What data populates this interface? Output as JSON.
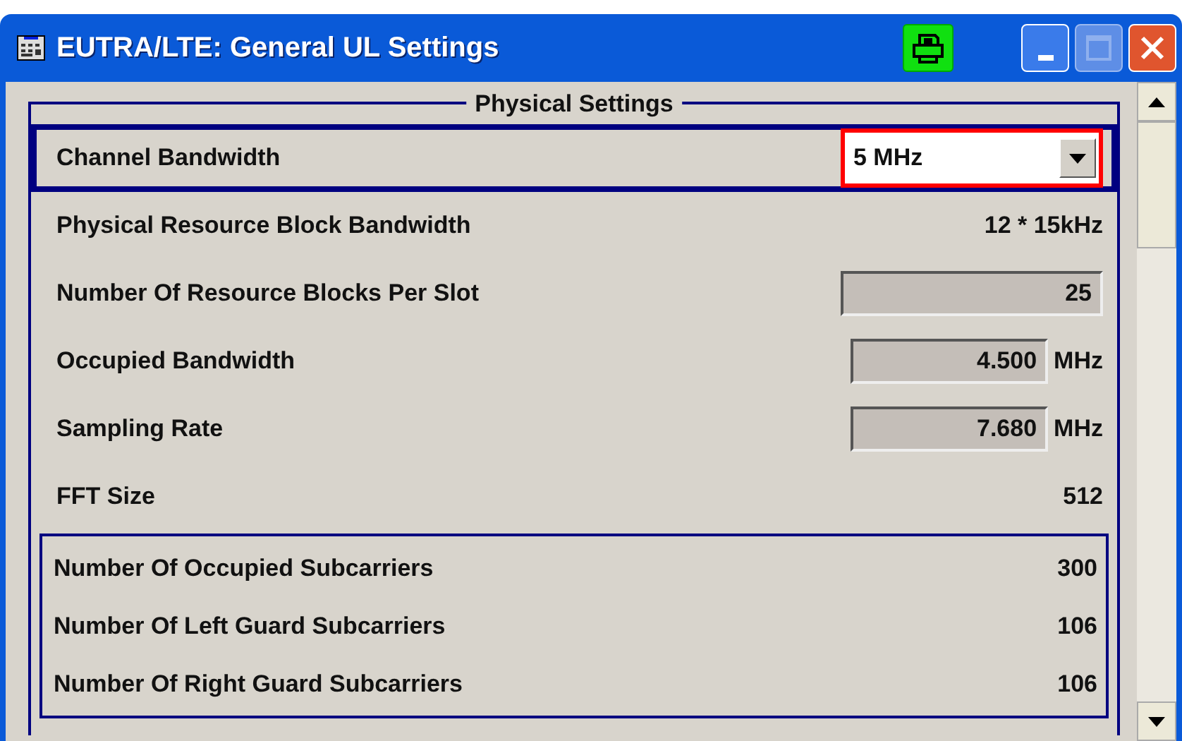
{
  "window": {
    "title": "EUTRA/LTE: General UL Settings"
  },
  "group": {
    "title": "Physical Settings",
    "rows": [
      {
        "kind": "dropdown",
        "label": "Channel Bandwidth",
        "value": "5 MHz",
        "selected": true
      },
      {
        "kind": "text",
        "label": "Physical Resource Block Bandwidth",
        "value": "12 * 15kHz",
        "selected": false
      },
      {
        "kind": "field",
        "label": "Number Of Resource Blocks Per Slot",
        "value": "25",
        "selected": false
      },
      {
        "kind": "field",
        "label": "Occupied Bandwidth",
        "value": "4.500",
        "unit": "MHz",
        "selected": false
      },
      {
        "kind": "field",
        "label": "Sampling Rate",
        "value": "7.680",
        "unit": "MHz",
        "selected": false
      },
      {
        "kind": "text",
        "label": "FFT Size",
        "value": "512",
        "selected": false
      }
    ],
    "subcarriers": [
      {
        "label": "Number Of Occupied Subcarriers",
        "value": "300"
      },
      {
        "label": "Number Of Left Guard Subcarriers",
        "value": "106"
      },
      {
        "label": "Number Of Right Guard Subcarriers",
        "value": "106"
      }
    ]
  }
}
